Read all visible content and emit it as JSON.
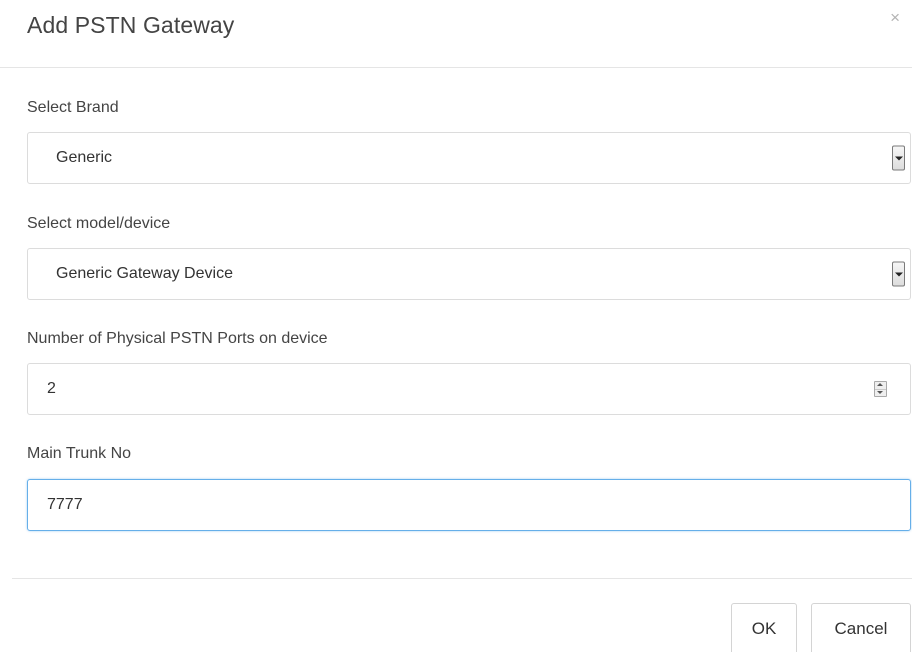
{
  "dialog": {
    "title": "Add PSTN Gateway",
    "close_glyph": "×"
  },
  "fields": {
    "brand": {
      "label": "Select Brand",
      "value": "Generic"
    },
    "model": {
      "label": "Select model/device",
      "value": "Generic Gateway Device"
    },
    "ports": {
      "label": "Number of Physical PSTN Ports on device",
      "value": "2"
    },
    "trunk": {
      "label": "Main Trunk No",
      "value": "7777"
    }
  },
  "footer": {
    "ok_label": "OK",
    "cancel_label": "Cancel"
  },
  "icons": {
    "close": "close-icon",
    "select_arrow": "chevron-down-icon",
    "spinner": "spinner-icon"
  },
  "colors": {
    "focus_border": "#66afe9",
    "divider": "#e5e5e5"
  }
}
